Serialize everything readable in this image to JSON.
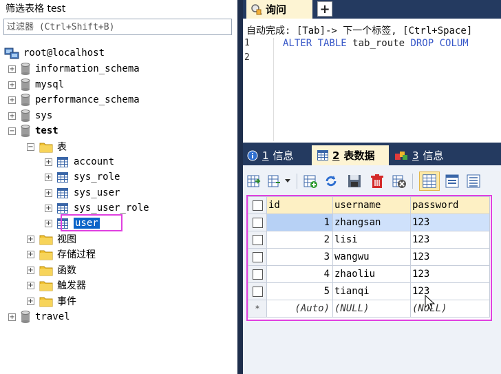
{
  "left_panel": {
    "title": "筛选表格 test",
    "filter_placeholder": "过滤器 (Ctrl+Shift+B)",
    "host": "root@localhost",
    "databases": [
      "information_schema",
      "mysql",
      "performance_schema",
      "sys"
    ],
    "current_db": "test",
    "tables_folder": "表",
    "tables": [
      "account",
      "sys_role",
      "sys_user",
      "sys_user_role",
      "user"
    ],
    "selected_table": "user",
    "other_folders": [
      "视图",
      "存储过程",
      "函数",
      "触发器",
      "事件"
    ],
    "last_db": "travel",
    "expand_plus": "+",
    "expand_minus": "−"
  },
  "query_tab": {
    "label": "询问",
    "add_label": "+",
    "autocomplete_hint": "自动完成: [Tab]-> 下一个标签, [Ctrl+Space]",
    "line_numbers": [
      "1",
      "2"
    ],
    "code": {
      "kw1": "ALTER TABLE",
      "ident1": "tab_route",
      "kw2": "DROP COLUM"
    }
  },
  "result_tabs": [
    {
      "num": "1",
      "label": "信息"
    },
    {
      "num": "2",
      "label": "表数据"
    },
    {
      "num": "3",
      "label": "信息"
    }
  ],
  "grid": {
    "columns": [
      "id",
      "username",
      "password"
    ],
    "rows": [
      {
        "id": "1",
        "username": "zhangsan",
        "password": "123"
      },
      {
        "id": "2",
        "username": "lisi",
        "password": "123"
      },
      {
        "id": "3",
        "username": "wangwu",
        "password": "123"
      },
      {
        "id": "4",
        "username": "zhaoliu",
        "password": "123"
      },
      {
        "id": "5",
        "username": "tianqi",
        "password": "123"
      }
    ],
    "new_row": {
      "marker": "*",
      "id": "(Auto)",
      "username": "(NULL)",
      "password": "(NULL)"
    }
  },
  "colors": {
    "highlight_border": "#e040e0",
    "tab_bar": "#243a60",
    "active_tab": "#fdf4d3",
    "selected_row": "#cfe1fb"
  }
}
